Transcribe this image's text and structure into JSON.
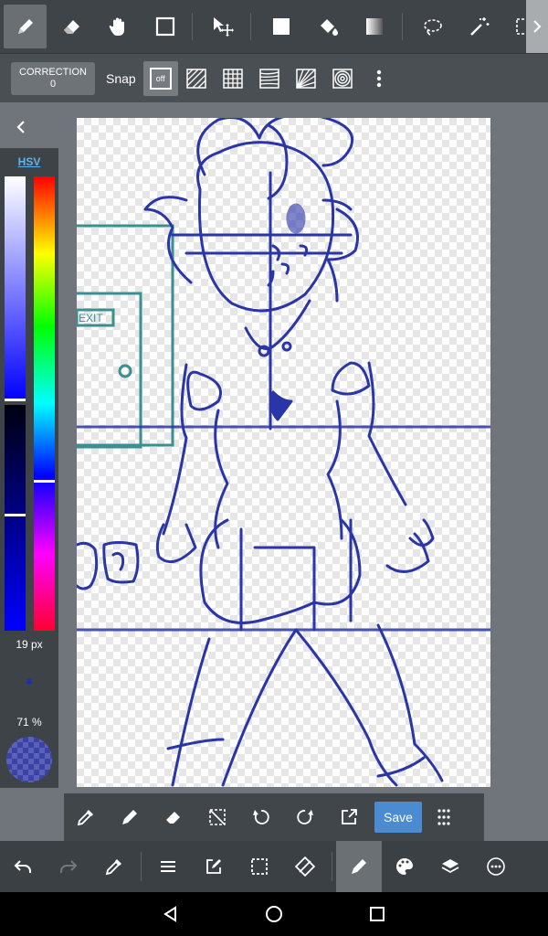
{
  "toolbar": {
    "tools": [
      "pen",
      "eraser",
      "hand",
      "rectangle",
      "move",
      "fill-rect",
      "bucket",
      "gradient",
      "lasso",
      "magic-wand",
      "select"
    ],
    "active_tool": "pen"
  },
  "sub_toolbar": {
    "correction_label": "CORRECTION",
    "correction_value": "0",
    "snap_label": "Snap",
    "snap_off_label": "off"
  },
  "color_panel": {
    "mode_label": "HSV",
    "brush_size": "19 px",
    "opacity": "71 %",
    "current_color": "#2a35a8",
    "sv_marker": 0.49,
    "value_marker": 0.74,
    "hue_marker": 0.67
  },
  "bottom_tools": {
    "save_label": "Save"
  },
  "colors": {
    "accent": "#4a8bd1",
    "stroke": "#2a35a8",
    "teal": "#3a8f93"
  }
}
